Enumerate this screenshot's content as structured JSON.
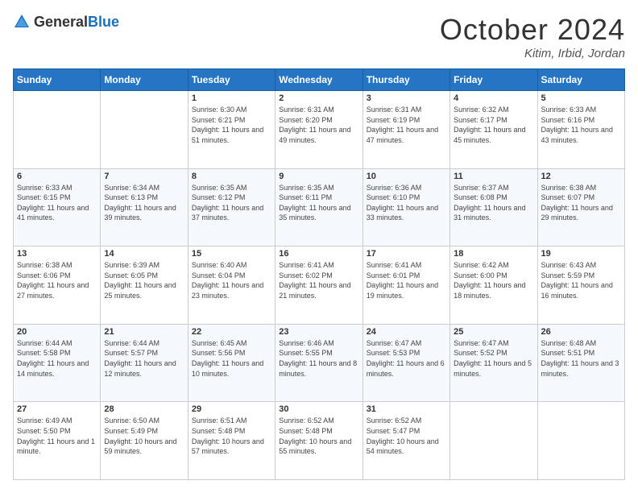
{
  "header": {
    "logo": {
      "text_general": "General",
      "text_blue": "Blue"
    },
    "title": "October 2024",
    "location": "Kitim, Irbid, Jordan"
  },
  "days_of_week": [
    "Sunday",
    "Monday",
    "Tuesday",
    "Wednesday",
    "Thursday",
    "Friday",
    "Saturday"
  ],
  "weeks": [
    [
      {
        "day": "",
        "info": ""
      },
      {
        "day": "",
        "info": ""
      },
      {
        "day": "1",
        "info": "Sunrise: 6:30 AM\nSunset: 6:21 PM\nDaylight: 11 hours and 51 minutes."
      },
      {
        "day": "2",
        "info": "Sunrise: 6:31 AM\nSunset: 6:20 PM\nDaylight: 11 hours and 49 minutes."
      },
      {
        "day": "3",
        "info": "Sunrise: 6:31 AM\nSunset: 6:19 PM\nDaylight: 11 hours and 47 minutes."
      },
      {
        "day": "4",
        "info": "Sunrise: 6:32 AM\nSunset: 6:17 PM\nDaylight: 11 hours and 45 minutes."
      },
      {
        "day": "5",
        "info": "Sunrise: 6:33 AM\nSunset: 6:16 PM\nDaylight: 11 hours and 43 minutes."
      }
    ],
    [
      {
        "day": "6",
        "info": "Sunrise: 6:33 AM\nSunset: 6:15 PM\nDaylight: 11 hours and 41 minutes."
      },
      {
        "day": "7",
        "info": "Sunrise: 6:34 AM\nSunset: 6:13 PM\nDaylight: 11 hours and 39 minutes."
      },
      {
        "day": "8",
        "info": "Sunrise: 6:35 AM\nSunset: 6:12 PM\nDaylight: 11 hours and 37 minutes."
      },
      {
        "day": "9",
        "info": "Sunrise: 6:35 AM\nSunset: 6:11 PM\nDaylight: 11 hours and 35 minutes."
      },
      {
        "day": "10",
        "info": "Sunrise: 6:36 AM\nSunset: 6:10 PM\nDaylight: 11 hours and 33 minutes."
      },
      {
        "day": "11",
        "info": "Sunrise: 6:37 AM\nSunset: 6:08 PM\nDaylight: 11 hours and 31 minutes."
      },
      {
        "day": "12",
        "info": "Sunrise: 6:38 AM\nSunset: 6:07 PM\nDaylight: 11 hours and 29 minutes."
      }
    ],
    [
      {
        "day": "13",
        "info": "Sunrise: 6:38 AM\nSunset: 6:06 PM\nDaylight: 11 hours and 27 minutes."
      },
      {
        "day": "14",
        "info": "Sunrise: 6:39 AM\nSunset: 6:05 PM\nDaylight: 11 hours and 25 minutes."
      },
      {
        "day": "15",
        "info": "Sunrise: 6:40 AM\nSunset: 6:04 PM\nDaylight: 11 hours and 23 minutes."
      },
      {
        "day": "16",
        "info": "Sunrise: 6:41 AM\nSunset: 6:02 PM\nDaylight: 11 hours and 21 minutes."
      },
      {
        "day": "17",
        "info": "Sunrise: 6:41 AM\nSunset: 6:01 PM\nDaylight: 11 hours and 19 minutes."
      },
      {
        "day": "18",
        "info": "Sunrise: 6:42 AM\nSunset: 6:00 PM\nDaylight: 11 hours and 18 minutes."
      },
      {
        "day": "19",
        "info": "Sunrise: 6:43 AM\nSunset: 5:59 PM\nDaylight: 11 hours and 16 minutes."
      }
    ],
    [
      {
        "day": "20",
        "info": "Sunrise: 6:44 AM\nSunset: 5:58 PM\nDaylight: 11 hours and 14 minutes."
      },
      {
        "day": "21",
        "info": "Sunrise: 6:44 AM\nSunset: 5:57 PM\nDaylight: 11 hours and 12 minutes."
      },
      {
        "day": "22",
        "info": "Sunrise: 6:45 AM\nSunset: 5:56 PM\nDaylight: 11 hours and 10 minutes."
      },
      {
        "day": "23",
        "info": "Sunrise: 6:46 AM\nSunset: 5:55 PM\nDaylight: 11 hours and 8 minutes."
      },
      {
        "day": "24",
        "info": "Sunrise: 6:47 AM\nSunset: 5:53 PM\nDaylight: 11 hours and 6 minutes."
      },
      {
        "day": "25",
        "info": "Sunrise: 6:47 AM\nSunset: 5:52 PM\nDaylight: 11 hours and 5 minutes."
      },
      {
        "day": "26",
        "info": "Sunrise: 6:48 AM\nSunset: 5:51 PM\nDaylight: 11 hours and 3 minutes."
      }
    ],
    [
      {
        "day": "27",
        "info": "Sunrise: 6:49 AM\nSunset: 5:50 PM\nDaylight: 11 hours and 1 minute."
      },
      {
        "day": "28",
        "info": "Sunrise: 6:50 AM\nSunset: 5:49 PM\nDaylight: 10 hours and 59 minutes."
      },
      {
        "day": "29",
        "info": "Sunrise: 6:51 AM\nSunset: 5:48 PM\nDaylight: 10 hours and 57 minutes."
      },
      {
        "day": "30",
        "info": "Sunrise: 6:52 AM\nSunset: 5:48 PM\nDaylight: 10 hours and 55 minutes."
      },
      {
        "day": "31",
        "info": "Sunrise: 6:52 AM\nSunset: 5:47 PM\nDaylight: 10 hours and 54 minutes."
      },
      {
        "day": "",
        "info": ""
      },
      {
        "day": "",
        "info": ""
      }
    ]
  ]
}
